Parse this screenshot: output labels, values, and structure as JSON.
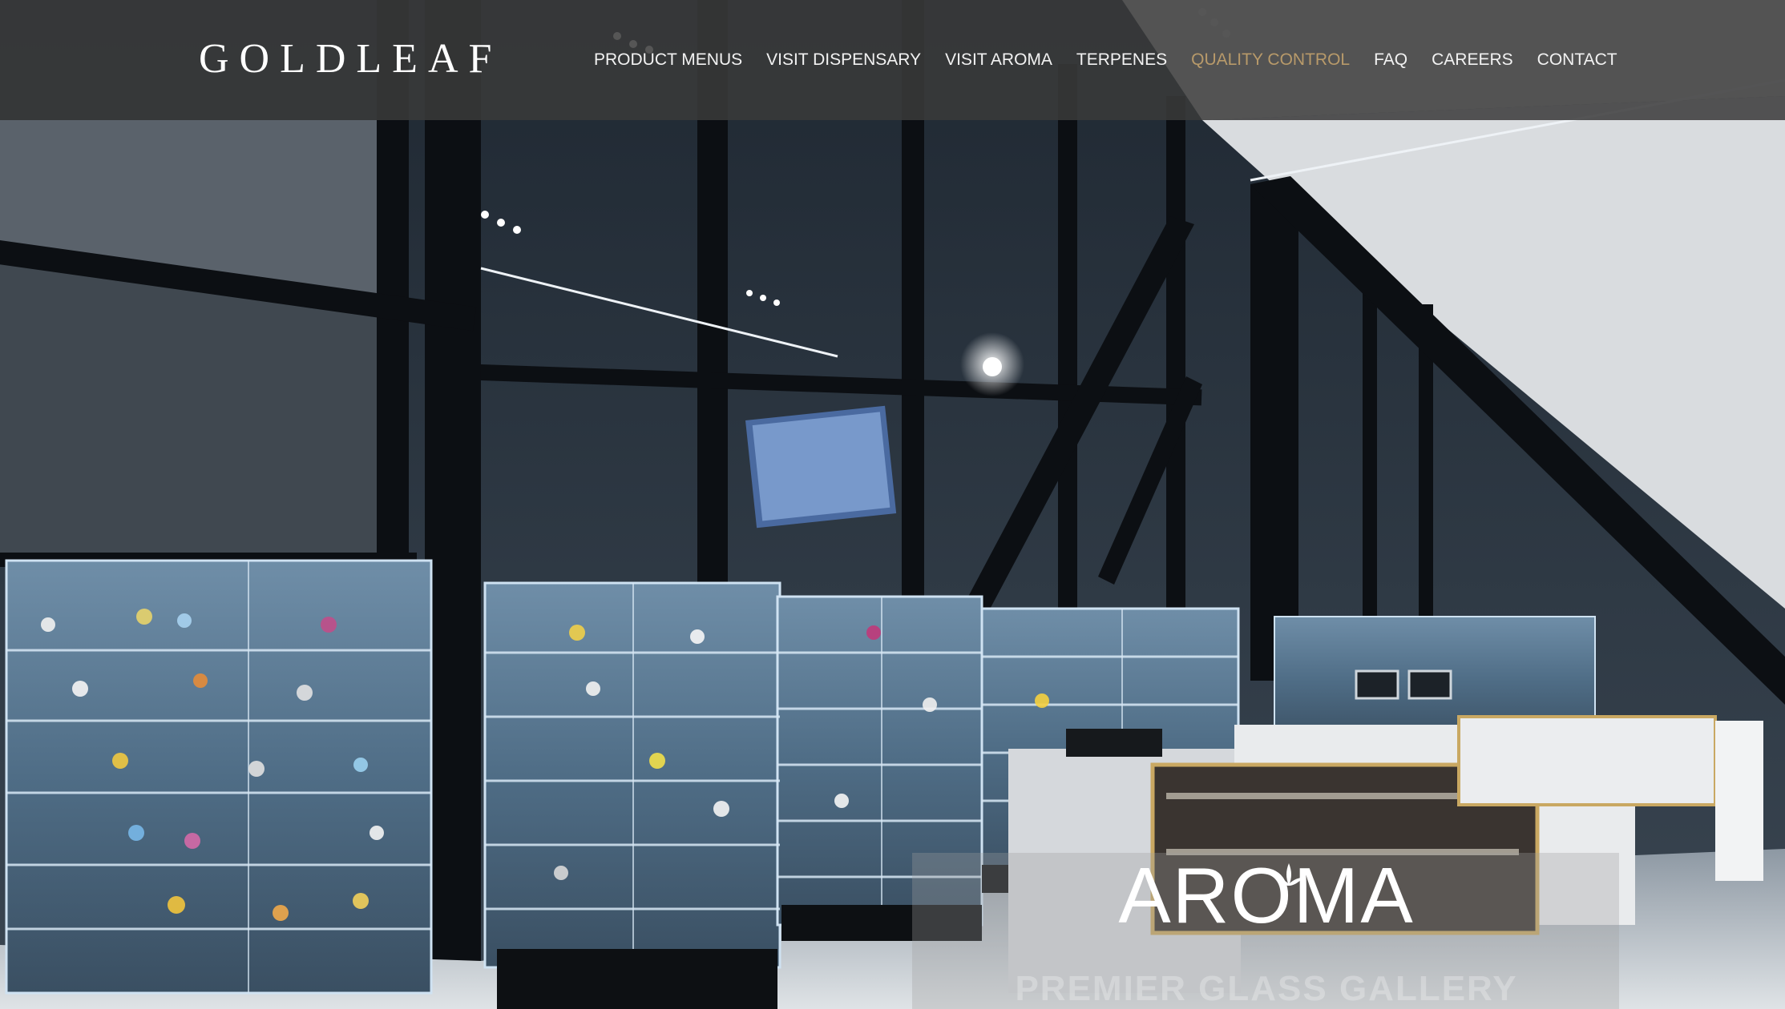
{
  "brand": {
    "logo_text": "GOLDLEAF"
  },
  "nav": {
    "items": [
      {
        "label": "PRODUCT MENUS",
        "active": false
      },
      {
        "label": "VISIT DISPENSARY",
        "active": false
      },
      {
        "label": "VISIT AROMA",
        "active": false
      },
      {
        "label": "TERPENES",
        "active": false
      },
      {
        "label": "QUALITY CONTROL",
        "active": true
      },
      {
        "label": "FAQ",
        "active": false
      },
      {
        "label": "CAREERS",
        "active": false
      },
      {
        "label": "CONTACT",
        "active": false
      }
    ]
  },
  "hero": {
    "aroma_logo": "AROMA",
    "aroma_tagline": "PREMIER GLASS GALLERY"
  },
  "colors": {
    "header_bg": "#3a3a3a",
    "nav_text": "#f2f2f2",
    "nav_active": "#b89a6a"
  }
}
